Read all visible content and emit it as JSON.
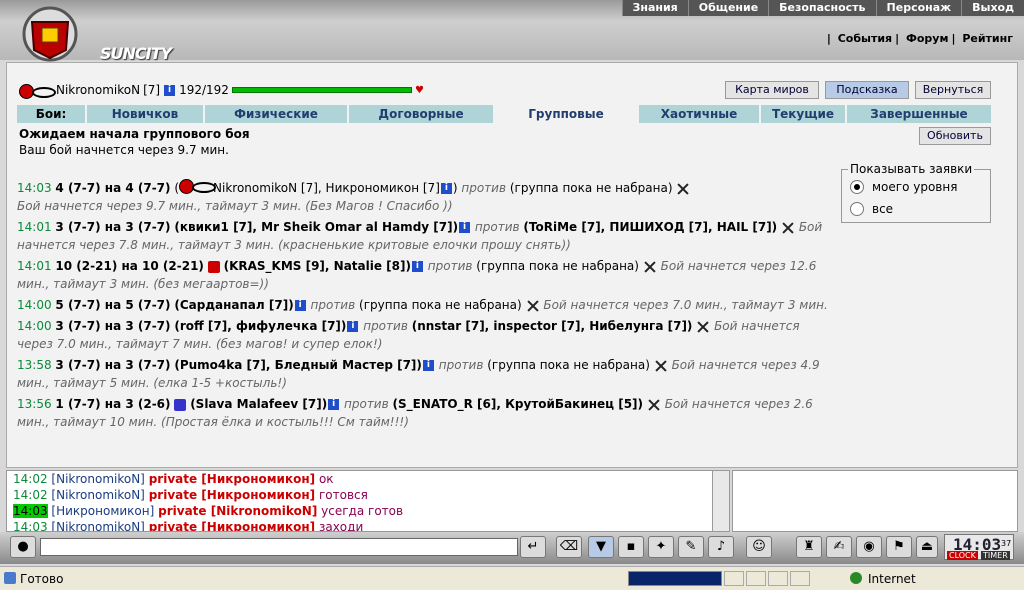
{
  "topmenu": [
    "Знания",
    "Общение",
    "Безопасность",
    "Персонаж",
    "Выход"
  ],
  "submenu": [
    "События",
    "Форум",
    "Рейтинг"
  ],
  "logo": "SUNCITY",
  "user": {
    "name": "NikronomikoN",
    "level": "[7]",
    "hp": "192/192"
  },
  "buttons": {
    "map": "Карта миров",
    "hint": "Подсказка",
    "back": "Вернуться",
    "refresh": "Обновить"
  },
  "tabs": {
    "label": "Бои:",
    "items": [
      "Новичков",
      "Физические",
      "Договорные",
      "Групповые",
      "Хаотичные",
      "Текущие",
      "Завершенные"
    ],
    "active": 3
  },
  "waiting": {
    "title": "Ожидаем начала группового боя",
    "sub": "Ваш бой начнется через 9.7 мин."
  },
  "filter": {
    "legend": "Показывать заявки",
    "opt1": "моего уровня",
    "opt2": "все",
    "selected": 1
  },
  "fights": [
    {
      "time": "14:03",
      "head": "4 (7-7) на 4 (7-7)",
      "left": "NikronomikoN [7], Никрономикон [7]",
      "vs": "против",
      "right": "(группа пока не набрана)",
      "note": "Бой начнется через 9.7 мин., таймаут 3 мин. (Без Магов ! Спасибо ))"
    },
    {
      "time": "14:01",
      "head": "3 (7-7) на 3 (7-7)",
      "left": "(квики1 [7], Mr Sheik Omar al Hamdy [7])",
      "vs": "против",
      "right": "(ToRiMe [7], ПИШИХОД [7], HAIL [7])",
      "note": "Бой начнется через 7.8 мин., таймаут 3 мин. (красненькие критовые елочки прошу снять))"
    },
    {
      "time": "14:01",
      "head": "10 (2-21) на 10 (2-21)",
      "left": "(KRAS_KMS [9], Natalie [8])",
      "vs": "против",
      "right": "(группа пока не набрана)",
      "note": "Бой начнется через 12.6 мин., таймаут 3 мин. (без мегаартов=))"
    },
    {
      "time": "14:00",
      "head": "5 (7-7) на 5 (7-7)",
      "left": "(Сарданапал [7])",
      "vs": "против",
      "right": "(группа пока не набрана)",
      "note": "Бой начнется через 7.0 мин., таймаут 3 мин."
    },
    {
      "time": "14:00",
      "head": "3 (7-7) на 3 (7-7)",
      "left": "(roff [7], фифулечка [7])",
      "vs": "против",
      "right": "(nnstar [7], inspector [7], Нибелунга [7])",
      "note": "Бой начнется через 7.0 мин., таймаут 7 мин. (без магов! и супер елок!)"
    },
    {
      "time": "13:58",
      "head": "3 (7-7) на 3 (7-7)",
      "left": "(Pumo4ka [7], Бледный Мастер [7])",
      "vs": "против",
      "right": "(группа пока не набрана)",
      "note": "Бой начнется через 4.9 мин., таймаут 5 мин. (елка 1-5 +костыль!)"
    },
    {
      "time": "13:56",
      "head": "1 (7-7) на 3 (2-6)",
      "left": "(Slava Malafeev [7])",
      "vs": "против",
      "right": "(S_ENATO_R [6], КрутойБакинец [5])",
      "note": "Бой начнется через 2.6 мин., таймаут 10 мин. (Простая ёлка и костыль!!! См тайм!!!)"
    }
  ],
  "chat": [
    {
      "t": "14:02",
      "n": "[NikronomikoN]",
      "p": "private [Никрономикон]",
      "m": "ок"
    },
    {
      "t": "14:02",
      "n": "[NikronomikoN]",
      "p": "private [Никрономикон]",
      "m": "готовся"
    },
    {
      "t": "14:03",
      "n": "[Никрономикон]",
      "p": "private [NikronomikoN]",
      "m": "усегда готов"
    },
    {
      "t": "14:03",
      "n": "[NikronomikoN]",
      "p": "private [Никрономикон]",
      "m": "заходи"
    }
  ],
  "clock": {
    "time": "14:03",
    "sec": "37",
    "clock": "CLOCK",
    "timer": "TIMER"
  },
  "status": {
    "ready": "Готово",
    "zone": "Internet",
    "progress": 1.0
  }
}
